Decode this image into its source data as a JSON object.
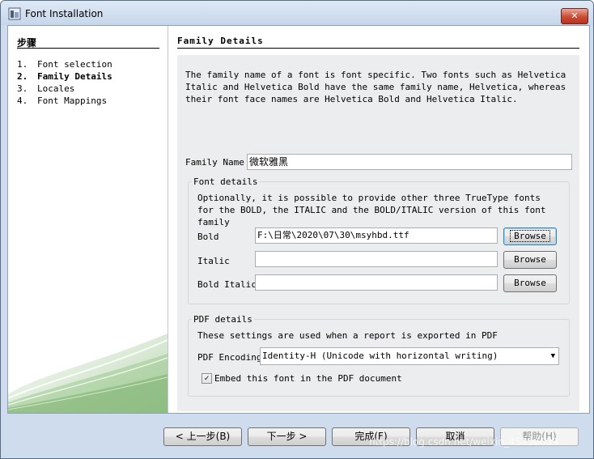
{
  "window": {
    "title": "Font Installation",
    "close_label": "✕"
  },
  "sidebar": {
    "heading": "步骤",
    "steps": [
      {
        "num": "1.",
        "label": "Font selection"
      },
      {
        "num": "2.",
        "label": "Family Details"
      },
      {
        "num": "3.",
        "label": "Locales"
      },
      {
        "num": "4.",
        "label": "Font Mappings"
      }
    ],
    "active_step": 2
  },
  "main": {
    "section_title": "Family Details",
    "description": "The family name of a font is font specific. Two fonts such as Helvetica Italic and Helvetica Bold have the same family name, Helvetica, whereas their font face names are Helvetica Bold and Helvetica Italic.",
    "family_name_label": "Family Name",
    "family_name_value": "微软雅黑",
    "font_details": {
      "legend": "Font details",
      "description": "Optionally, it is possible to provide other three TrueType fonts for the BOLD, the ITALIC and the BOLD/ITALIC version of this font family",
      "rows": [
        {
          "label": "Bold",
          "value": "F:\\日常\\2020\\07\\30\\msyhbd.ttf",
          "button": "Browse"
        },
        {
          "label": "Italic",
          "value": "",
          "button": "Browse"
        },
        {
          "label": "Bold Italic",
          "value": "",
          "button": "Browse"
        }
      ]
    },
    "pdf_details": {
      "legend": "PDF details",
      "description": "These settings are used when a report is exported in PDF",
      "encoding_label": "PDF Encoding",
      "encoding_value": "Identity-H (Unicode with horizontal writing)",
      "embed_label": "Embed this font in the PDF document",
      "embed_checked": true,
      "check_mark": "✓"
    }
  },
  "footer": {
    "back": "< 上一步(B)",
    "next": "下一步 >",
    "finish": "完成(F)",
    "cancel": "取消",
    "help": "帮助(H)"
  },
  "watermark": "https://blog.csdn.net/weixin_45156039"
}
